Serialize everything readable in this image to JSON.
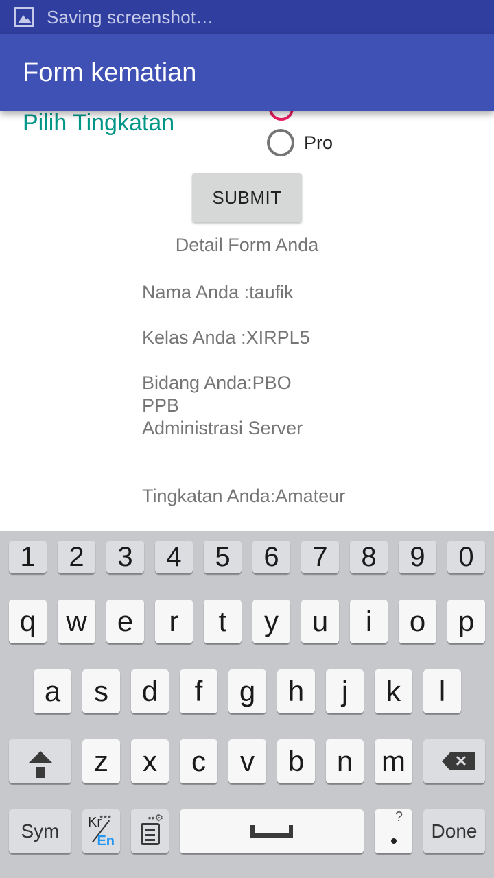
{
  "status_bar": {
    "text": "Saving screenshot…",
    "icon": "image-icon"
  },
  "app_bar": {
    "title": "Form kematian"
  },
  "form": {
    "level_label": "Pilih Tingkatan",
    "radio_option_pro": "Pro",
    "submit_label": "SUBMIT",
    "detail_title": "Detail Form Anda",
    "detail_name": "Nama Anda :taufik",
    "detail_class": "Kelas Anda :XIRPL5",
    "detail_field_1": "Bidang Anda:PBO",
    "detail_field_2": "PPB",
    "detail_field_3": "Administrasi Server",
    "detail_level": "Tingkatan Anda:Amateur",
    "accent_color": "#009688",
    "radio_selected_color": "#e91e63"
  },
  "keyboard": {
    "numbers": [
      "1",
      "2",
      "3",
      "4",
      "5",
      "6",
      "7",
      "8",
      "9",
      "0"
    ],
    "row1": [
      "q",
      "w",
      "e",
      "r",
      "t",
      "y",
      "u",
      "i",
      "o",
      "p"
    ],
    "row2": [
      "a",
      "s",
      "d",
      "f",
      "g",
      "h",
      "j",
      "k",
      "l"
    ],
    "row3": [
      "z",
      "x",
      "c",
      "v",
      "b",
      "n",
      "m"
    ],
    "sym_label": "Sym",
    "lang_kr": "Kr",
    "lang_en": "En",
    "done_label": "Done",
    "period_top": "?"
  }
}
